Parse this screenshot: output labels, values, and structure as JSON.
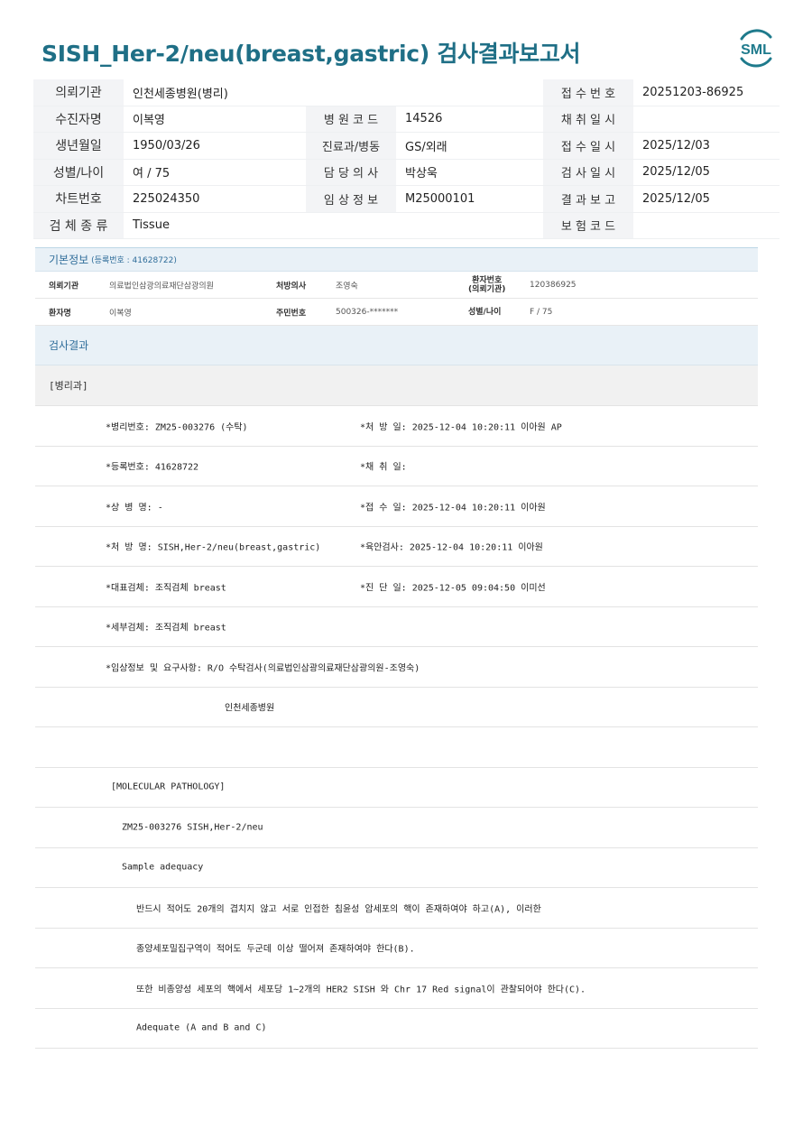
{
  "report": {
    "title": "SISH_Her-2/neu(breast,gastric) 검사결과보고서",
    "logo_text": "SML"
  },
  "header": {
    "rows": [
      {
        "l1": "의뢰기관",
        "v1": "인천세종병원(병리)",
        "l2": "",
        "v2": "",
        "l3": "접 수 번 호",
        "v3": "20251203-86925"
      },
      {
        "l1": "수진자명",
        "v1": "이복영",
        "l2": "병 원 코 드",
        "v2": "14526",
        "l3": "채 취 일 시",
        "v3": ""
      },
      {
        "l1": "생년월일",
        "v1": "1950/03/26",
        "l2": "진료과/병동",
        "v2": "GS/외래",
        "l3": "접 수 일 시",
        "v3": "2025/12/03"
      },
      {
        "l1": "성별/나이",
        "v1": "여 / 75",
        "l2": "담 당 의 사",
        "v2": "박상욱",
        "l3": "검 사 일 시",
        "v3": "2025/12/05"
      },
      {
        "l1": "차트번호",
        "v1": "225024350",
        "l2": "임 상 정 보",
        "v2": "M25000101",
        "l3": "결 과 보 고",
        "v3": "2025/12/05"
      },
      {
        "l1": "검 체 종 류",
        "v1": "Tissue",
        "l2": "",
        "v2": "",
        "l3": "보 험 코 드",
        "v3": ""
      }
    ]
  },
  "basic_info": {
    "title": "기본정보",
    "reg_note": "(등록번호 : 41628722)",
    "rows": [
      {
        "k1": "의뢰기관",
        "v1": "의료법인삼광의료재단삼광의원",
        "k2": "처방의사",
        "v2": "조영숙",
        "k3a": "환자번호",
        "k3b": "(의뢰기관)",
        "v3": "120386925"
      },
      {
        "k1": "환자명",
        "v1": "이복영",
        "k2": "주민번호",
        "v2": "500326-*******",
        "k3a": "성별/나이",
        "k3b": "",
        "v3": "F / 75"
      }
    ]
  },
  "results": {
    "title": "검사결과",
    "dept": "[병리과]",
    "lines": [
      {
        "left": "*병리번호: ZM25-003276 (수탁)",
        "right": "*처 방 일: 2025-12-04 10:20:11  이아원 AP",
        "indent": 0
      },
      {
        "left": "*등록번호: 41628722",
        "right": "*채 취 일:",
        "indent": 0
      },
      {
        "left": "*상 병 명: -",
        "right": "*접 수 일: 2025-12-04 10:20:11  이아원",
        "indent": 0
      },
      {
        "left": "*처 방 명: SISH,Her-2/neu(breast,gastric)",
        "right": "*육안검사: 2025-12-04 10:20:11  이아원",
        "indent": 0
      },
      {
        "left": "*대표검체: 조직검체 breast",
        "right": "*진 단 일: 2025-12-05 09:04:50  이미선",
        "indent": 0
      },
      {
        "left": "*세부검체: 조직검체 breast",
        "right": "",
        "indent": 0
      },
      {
        "left": "*임상정보 및 요구사항: R/O 수탁검사(의료법인삼광의료재단삼광의원-조영숙)",
        "right": "",
        "indent": 0
      },
      {
        "left": "인천세종병원",
        "right": "",
        "indent": 3
      },
      {
        "left": "",
        "right": "",
        "indent": 0
      },
      {
        "left": "[MOLECULAR PATHOLOGY]",
        "right": "",
        "indent": 1
      },
      {
        "left": "ZM25-003276     SISH,Her-2/neu",
        "right": "",
        "indent": 2
      },
      {
        "left": "Sample adequacy",
        "right": "",
        "indent": 2
      },
      {
        "left": "반드시 적어도 20개의 겹치지 않고 서로 인접한 침윤성 암세포의 핵이 존재하여야 하고(A), 이러한",
        "right": "",
        "indent": 4
      },
      {
        "left": "종양세포밀집구역이 적어도 두군데 이상 떨어져 존재하여야 한다(B).",
        "right": "",
        "indent": 4
      },
      {
        "left": "또한 비종양성 세포의 핵에서 세포당 1~2개의 HER2 SISH 와 Chr 17 Red signal이 관찰되어야 한다(C).",
        "right": "",
        "indent": 4
      },
      {
        "left": "Adequate (A and B and C)",
        "right": "",
        "indent": 4
      }
    ]
  },
  "colors": {
    "title": "#1f6f86",
    "logo": "#1e7a8c",
    "section_bar": "#e9f1f7",
    "section_text": "#2f6d9a"
  }
}
